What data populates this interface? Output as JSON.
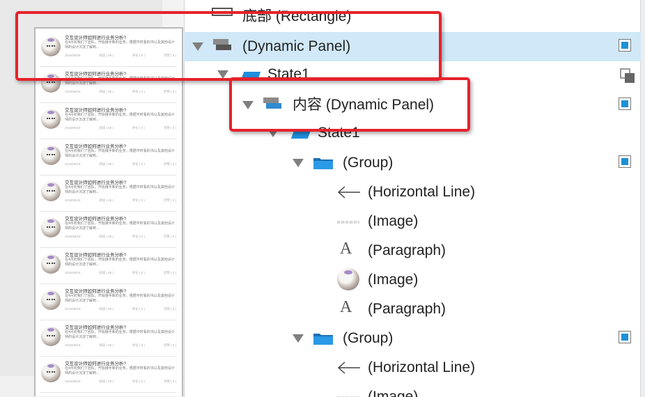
{
  "preview": {
    "items": [
      {
        "title": "交互设计师如何进行业务分析?",
        "desc": "在4月初我们了团队，开始接手新的业务。根据平时看的书以及其他设计师的设计沉淀了解到...",
        "date": "2016/05/18",
        "views": "阅读 ( 60 )",
        "comments": "评论 ( 0 )",
        "likes": "点赞 ( 0 )"
      },
      {
        "title": "交互设计师如何进行业务分析?",
        "desc": "在4月初我们了团队，开始接手新的业务。根据平时看的书以及其他设计师的设计沉淀了解到...",
        "date": "2016/05/18",
        "views": "阅读 ( 60 )",
        "comments": "评论 ( 0 )",
        "likes": "点赞 ( 0 )"
      },
      {
        "title": "交互设计师如何进行业务分析?",
        "desc": "在4月初我们了团队，开始接手新的业务。根据平时看的书以及其他设计师的设计沉淀了解到...",
        "date": "2016/05/18",
        "views": "阅读 ( 60 )",
        "comments": "评论 ( 0 )",
        "likes": "点赞 ( 0 )"
      },
      {
        "title": "交互设计师如何进行业务分析?",
        "desc": "在4月初我们了团队，开始接手新的业务。根据平时看的书以及其他设计师的设计沉淀了解到...",
        "date": "2016/05/18",
        "views": "阅读 ( 60 )",
        "comments": "评论 ( 0 )",
        "likes": "点赞 ( 0 )"
      },
      {
        "title": "交互设计师如何进行业务分析?",
        "desc": "在4月初我们了团队，开始接手新的业务。根据平时看的书以及其他设计师的设计沉淀了解到...",
        "date": "2016/05/18",
        "views": "阅读 ( 60 )",
        "comments": "评论 ( 0 )",
        "likes": "点赞 ( 0 )"
      },
      {
        "title": "交互设计师如何进行业务分析?",
        "desc": "在4月初我们了团队，开始接手新的业务。根据平时看的书以及其他设计师的设计沉淀了解到...",
        "date": "2016/05/18",
        "views": "阅读 ( 60 )",
        "comments": "评论 ( 0 )",
        "likes": "点赞 ( 0 )"
      },
      {
        "title": "交互设计师如何进行业务分析?",
        "desc": "在4月初我们了团队，开始接手新的业务。根据平时看的书以及其他设计师的设计沉淀了解到...",
        "date": "2016/05/18",
        "views": "阅读 ( 60 )",
        "comments": "评论 ( 0 )",
        "likes": "点赞 ( 0 )"
      },
      {
        "title": "交互设计师如何进行业务分析?",
        "desc": "在4月初我们了团队，开始接手新的业务。根据平时看的书以及其他设计师的设计沉淀了解到...",
        "date": "2016/05/18",
        "views": "阅读 ( 60 )",
        "comments": "评论 ( 0 )",
        "likes": "点赞 ( 0 )"
      },
      {
        "title": "交互设计师如何进行业务分析?",
        "desc": "在4月初我们了团队，开始接手新的业务。根据平时看的书以及其他设计师的设计沉淀了解到...",
        "date": "2016/05/18",
        "views": "阅读 ( 60 )",
        "comments": "评论 ( 0 )",
        "likes": "点赞 ( 0 )"
      },
      {
        "title": "交互设计师如何进行业务分析?",
        "desc": "在4月初我们了团队，开始接手新的业务。根据平时看的书以及其他设计师的设计沉淀了解到...",
        "date": "2016/05/18",
        "views": "阅读 ( 60 )",
        "comments": "评论 ( 0 )",
        "likes": "点赞 ( 0 )"
      }
    ]
  },
  "tree": {
    "rows": [
      {
        "label": "底部 (Rectangle)",
        "icon": "rectangle-icon"
      },
      {
        "label": "(Dynamic Panel)",
        "icon": "dynamic-panel-icon"
      },
      {
        "label": "State1",
        "icon": "state-icon"
      },
      {
        "label": "内容 (Dynamic Panel)",
        "icon": "dynamic-panel-icon"
      },
      {
        "label": "State1",
        "icon": "state-icon"
      },
      {
        "label": "(Group)",
        "icon": "folder-icon"
      },
      {
        "label": "(Horizontal Line)",
        "icon": "horizontal-line-icon"
      },
      {
        "label": "(Image)",
        "icon": "image-placeholder-icon"
      },
      {
        "label": "(Paragraph)",
        "icon": "paragraph-icon"
      },
      {
        "label": "(Image)",
        "icon": "avatar-image-icon"
      },
      {
        "label": "(Paragraph)",
        "icon": "paragraph-icon"
      },
      {
        "label": "(Group)",
        "icon": "folder-icon"
      },
      {
        "label": "(Horizontal Line)",
        "icon": "horizontal-line-icon"
      },
      {
        "label": "(Image)",
        "icon": "image-placeholder-icon"
      }
    ]
  },
  "colors": {
    "selection": "#d0e8f7",
    "highlight_box": "#e5222b",
    "state_blue": "#1f8fdc"
  }
}
